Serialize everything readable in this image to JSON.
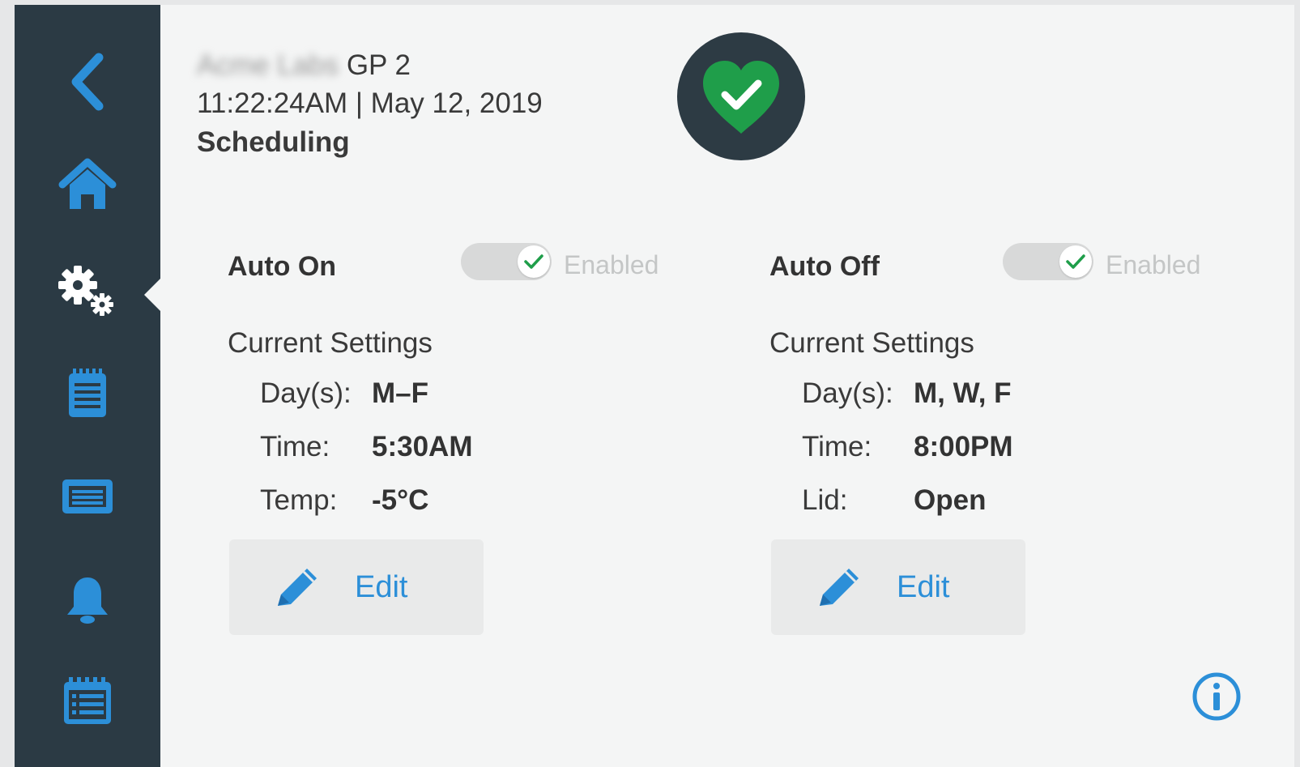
{
  "header": {
    "device_prefix": "Acme Labs",
    "device_name": "GP 2",
    "datetime": "11:22:24AM | May 12, 2019",
    "title": "Scheduling"
  },
  "status": {
    "icon": "heart-check-icon",
    "color": "#1f9e4a"
  },
  "sidebar": {
    "items": [
      {
        "icon": "back-chevron-icon"
      },
      {
        "icon": "home-icon"
      },
      {
        "icon": "settings-gears-icon",
        "selected": true
      },
      {
        "icon": "notepad-icon"
      },
      {
        "icon": "display-icon"
      },
      {
        "icon": "bell-icon"
      },
      {
        "icon": "calendar-list-icon"
      }
    ],
    "accent": "#2c8fd8"
  },
  "auto_on": {
    "title": "Auto On",
    "toggle_label": "Enabled",
    "enabled": true,
    "current_settings": "Current Settings",
    "rows": [
      {
        "label": "Day(s):",
        "value": "M–F"
      },
      {
        "label": "Time:",
        "value": "5:30AM"
      },
      {
        "label": "Temp:",
        "value": "-5°C"
      }
    ],
    "edit_label": "Edit"
  },
  "auto_off": {
    "title": "Auto Off",
    "toggle_label": "Enabled",
    "enabled": true,
    "current_settings": "Current Settings",
    "rows": [
      {
        "label": "Day(s):",
        "value": "M, W, F"
      },
      {
        "label": "Time:",
        "value": "8:00PM"
      },
      {
        "label": "Lid:",
        "value": "Open"
      }
    ],
    "edit_label": "Edit"
  },
  "info": {
    "icon": "info-icon"
  }
}
